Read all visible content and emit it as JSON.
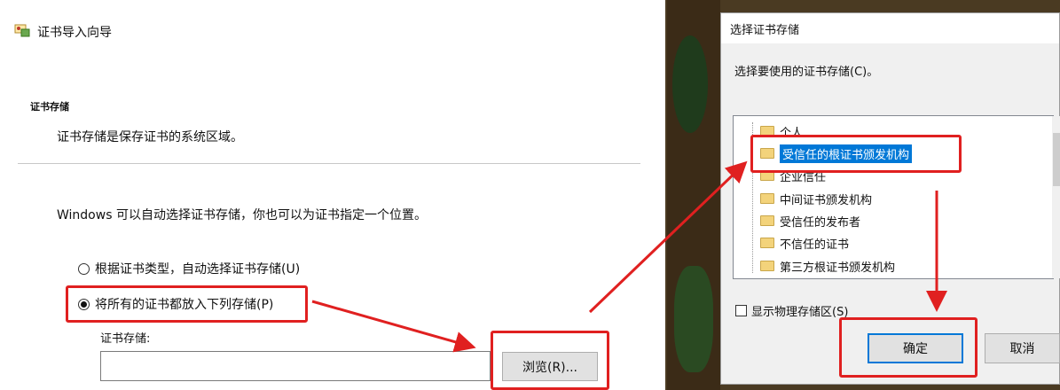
{
  "wizard": {
    "title": "证书导入向导",
    "section_heading": "证书存储",
    "section_desc": "证书存储是保存证书的系统区域。",
    "intro": "Windows 可以自动选择证书存储，你也可以为证书指定一个位置。",
    "radio_auto": "根据证书类型，自动选择证书存储(U)",
    "radio_manual": "将所有的证书都放入下列存储(P)",
    "store_label": "证书存储:",
    "store_value": "",
    "browse_label": "浏览(R)..."
  },
  "dialog": {
    "title": "选择证书存储",
    "prompt": "选择要使用的证书存储(C)。",
    "stores": [
      "个人",
      "受信任的根证书颁发机构",
      "企业信任",
      "中间证书颁发机构",
      "受信任的发布者",
      "不信任的证书",
      "第三方根证书颁发机构"
    ],
    "selected_store": "受信任的根证书颁发机构",
    "show_physical": "显示物理存储区(S)",
    "ok_label": "确定",
    "cancel_label": "取消"
  },
  "colors": {
    "highlight": "#e02020",
    "selection": "#0078d7"
  }
}
